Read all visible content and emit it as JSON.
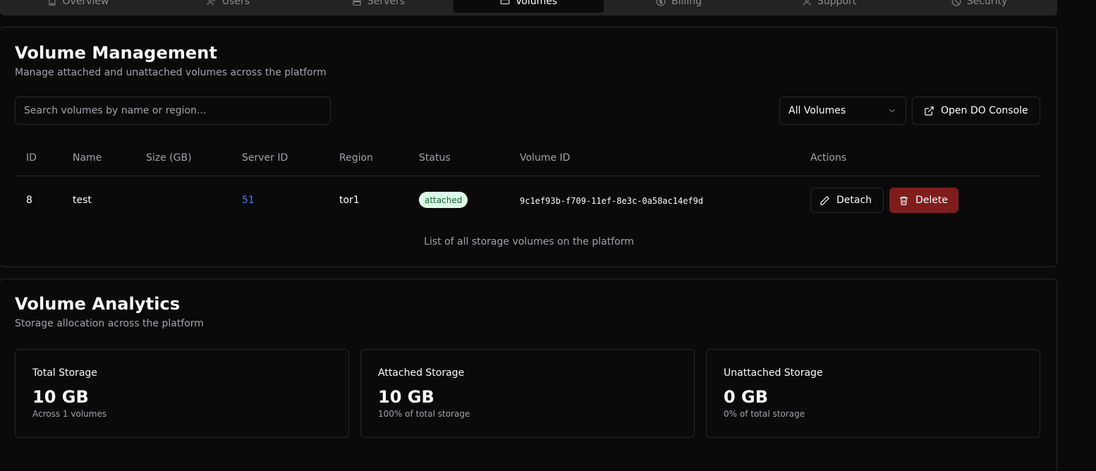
{
  "tabs": [
    {
      "label": "Overview",
      "icon": "building-icon"
    },
    {
      "label": "Users",
      "icon": "users-icon"
    },
    {
      "label": "Servers",
      "icon": "server-icon"
    },
    {
      "label": "Volumes",
      "icon": "hard-drive-icon",
      "active": true
    },
    {
      "label": "Billing",
      "icon": "dollar-icon"
    },
    {
      "label": "Support",
      "icon": "support-icon"
    },
    {
      "label": "Security",
      "icon": "ban-icon"
    }
  ],
  "volume_management": {
    "title": "Volume Management",
    "description": "Manage attached and unattached volumes across the platform",
    "search_placeholder": "Search volumes by name or region...",
    "filter_value": "All Volumes",
    "console_button": "Open DO Console",
    "columns": [
      "ID",
      "Name",
      "Size (GB)",
      "Server ID",
      "Region",
      "Status",
      "Volume ID",
      "Actions"
    ],
    "rows": [
      {
        "id": "8",
        "name": "test",
        "size": "",
        "server_id": "51",
        "region": "tor1",
        "status": "attached",
        "volume_id": "9c1ef93b-f709-11ef-8e3c-0a58ac14ef9d",
        "detach_label": "Detach",
        "delete_label": "Delete"
      }
    ],
    "caption": "List of all storage volumes on the platform"
  },
  "volume_analytics": {
    "title": "Volume Analytics",
    "description": "Storage allocation across the platform",
    "stats": [
      {
        "label": "Total Storage",
        "value": "10 GB",
        "sub": "Across 1 volumes"
      },
      {
        "label": "Attached Storage",
        "value": "10 GB",
        "sub": "100% of total storage"
      },
      {
        "label": "Unattached Storage",
        "value": "0 GB",
        "sub": "0% of total storage"
      }
    ]
  },
  "colors": {
    "background": "#0a0a0b",
    "border": "#27272a",
    "link": "#3b82f6",
    "delete": "#7f1d1d",
    "badge_bg": "#dcfce7",
    "badge_text": "#166534"
  }
}
